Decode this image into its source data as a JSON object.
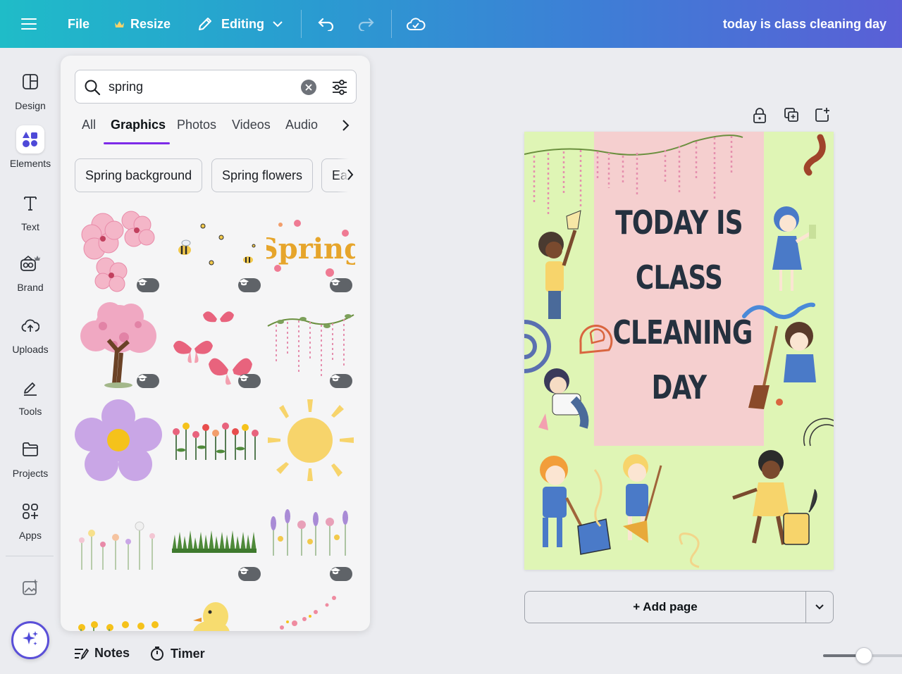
{
  "topbar": {
    "menu_icon": "hamburger-icon",
    "file_label": "File",
    "resize_label": "Resize",
    "editing_label": "Editing",
    "document_title": "today is class cleaning day"
  },
  "rail": {
    "items": [
      {
        "label": "Design",
        "icon": "design-icon"
      },
      {
        "label": "Elements",
        "icon": "elements-icon"
      },
      {
        "label": "Text",
        "icon": "text-icon"
      },
      {
        "label": "Brand",
        "icon": "brand-icon"
      },
      {
        "label": "Uploads",
        "icon": "uploads-icon"
      },
      {
        "label": "Tools",
        "icon": "tools-icon"
      },
      {
        "label": "Projects",
        "icon": "projects-icon"
      },
      {
        "label": "Apps",
        "icon": "apps-icon"
      }
    ],
    "active": "Elements"
  },
  "panel": {
    "search_value": "spring",
    "tabs": [
      "All",
      "Graphics",
      "Photos",
      "Videos",
      "Audio"
    ],
    "active_tab": "Graphics",
    "chips": [
      "Spring background",
      "Spring flowers",
      "Eas"
    ],
    "spring_word": "Spring"
  },
  "poster": {
    "title_lines": [
      "TODAY IS",
      "CLASS",
      "CLEANING",
      "DAY"
    ],
    "background_color": "#dff5b5",
    "block_color": "#f5cfcf"
  },
  "canvas": {
    "add_page_label": "+ Add page"
  },
  "bottombar": {
    "notes_label": "Notes",
    "timer_label": "Timer"
  },
  "colors": {
    "accent": "#7d2ae8",
    "elements_icon": "#4e49d8"
  }
}
